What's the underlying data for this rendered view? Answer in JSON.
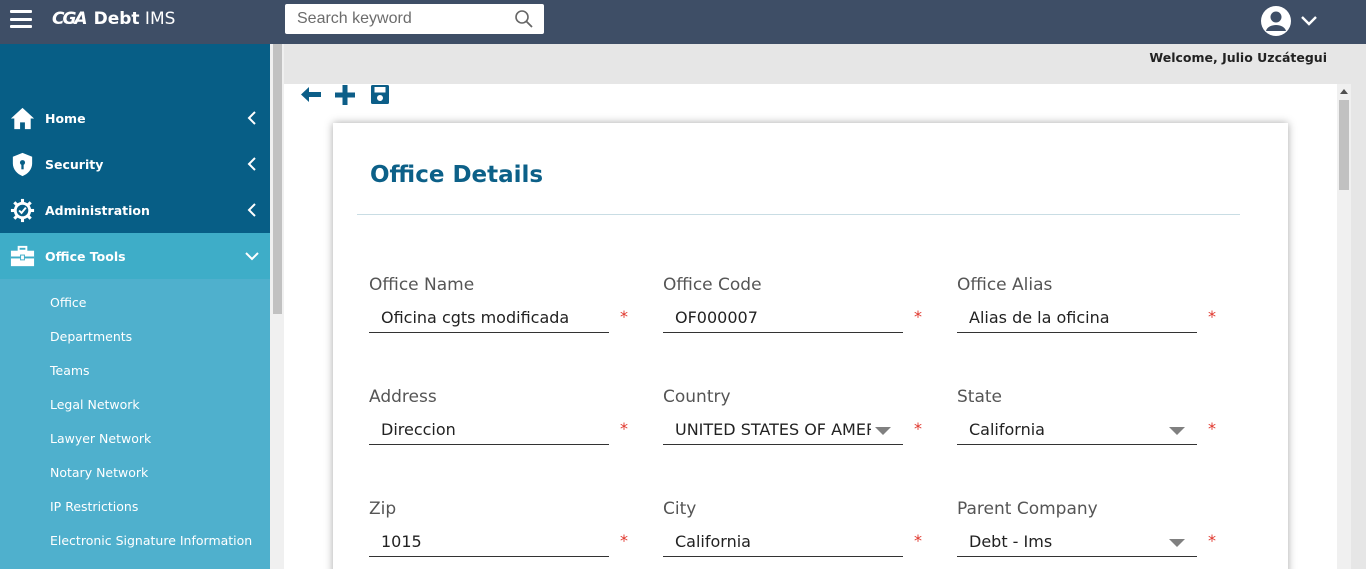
{
  "topbar": {
    "logo_mark": "CGA",
    "logo_bold": "Debt",
    "logo_rest": " IMS",
    "search_placeholder": "Search keyword",
    "icons": [
      "menu-icon",
      "search-icon",
      "user-avatar-icon",
      "chevron-down-icon"
    ]
  },
  "sidebar": {
    "items": [
      {
        "label": "Home",
        "icon": "home-icon",
        "expanded": false
      },
      {
        "label": "Security",
        "icon": "shield-icon",
        "expanded": false
      },
      {
        "label": "Administration",
        "icon": "gear-icon",
        "expanded": false
      },
      {
        "label": "Office Tools",
        "icon": "toolbox-icon",
        "expanded": true
      }
    ],
    "submenu": [
      "Office",
      "Departments",
      "Teams",
      "Legal Network",
      "Lawyer Network",
      "Notary Network",
      "IP Restrictions",
      "Electronic Signature Information"
    ]
  },
  "header": {
    "welcome": "Welcome, Julio Uzcátegui"
  },
  "toolbar": {
    "icons": [
      "back-arrow-icon",
      "add-icon",
      "save-icon"
    ]
  },
  "form": {
    "title": "Office Details",
    "required_mark": "*",
    "fields": {
      "office_name": {
        "label": "Office Name",
        "value": "Oficina cgts modificada"
      },
      "office_code": {
        "label": "Office Code",
        "value": "OF000007"
      },
      "office_alias": {
        "label": "Office Alias",
        "value": "Alias de la oficina"
      },
      "address": {
        "label": "Address",
        "value": "Direccion"
      },
      "country": {
        "label": "Country",
        "value": "UNITED STATES OF AMERICA"
      },
      "state": {
        "label": "State",
        "value": "California"
      },
      "zip": {
        "label": "Zip",
        "value": "1015"
      },
      "city": {
        "label": "City",
        "value": "California"
      },
      "parent_company": {
        "label": "Parent Company",
        "value": "Debt - Ims"
      }
    }
  },
  "colors": {
    "topbar": "#3e4e66",
    "sidebar": "#075e86",
    "sidebar_active": "#3eadc8",
    "submenu": "#4fb0cd",
    "title": "#0c6088",
    "required": "#e0362c"
  }
}
